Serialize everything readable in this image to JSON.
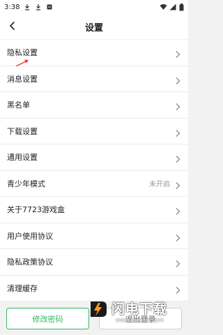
{
  "status_bar": {
    "time": "3:38"
  },
  "header": {
    "title": "设置"
  },
  "settings": [
    {
      "label": "隐私设置",
      "value": ""
    },
    {
      "label": "消息设置",
      "value": ""
    },
    {
      "label": "黑名单",
      "value": ""
    },
    {
      "label": "下载设置",
      "value": ""
    },
    {
      "label": "通用设置",
      "value": ""
    },
    {
      "label": "青少年模式",
      "value": "未开启"
    },
    {
      "label": "关于7723游戏盒",
      "value": ""
    },
    {
      "label": "用户使用协议",
      "value": ""
    },
    {
      "label": "隐私政策协议",
      "value": ""
    },
    {
      "label": "清理缓存",
      "value": ""
    }
  ],
  "buttons": {
    "change_password": "修改密码",
    "logout": "退出登录"
  },
  "watermark": {
    "name": "闪电下载",
    "url": "www.dianlut.com"
  },
  "colors": {
    "accent": "#2fb95d",
    "annotation": "#e53935"
  }
}
